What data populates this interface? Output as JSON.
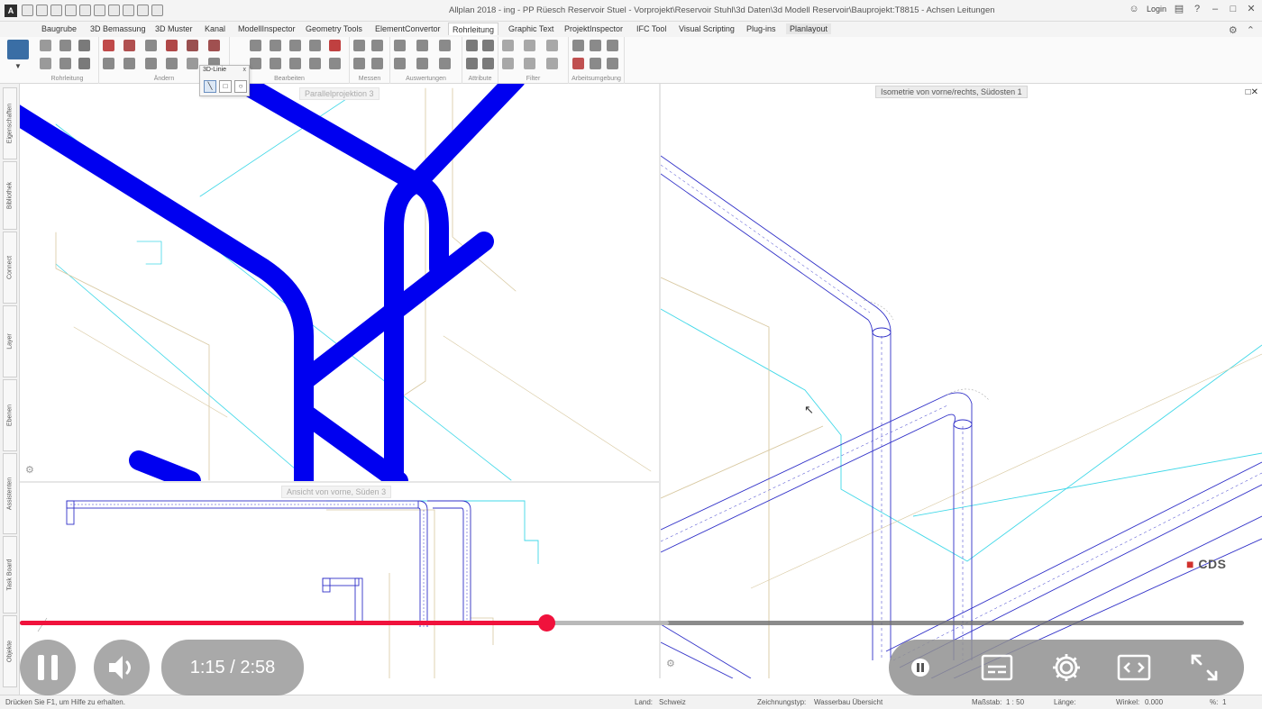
{
  "window": {
    "app_letter": "A",
    "title": "Allplan 2018 - ing - PP Rüesch Reservoir Stuel - Vorprojekt\\Reservoir Stuhl\\3d Daten\\3d Modell Reservoir\\Bauprojekt:T8815 - Achsen Leitungen",
    "login_label": "Login"
  },
  "ribbon": {
    "tabs": [
      "Baugrube",
      "3D Bemassung",
      "3D Muster",
      "Kanal",
      "ModellInspector",
      "Geometry Tools",
      "ElementConvertor",
      "Rohrleitung",
      "Graphic Text",
      "ProjektInspector",
      "IFC Tool",
      "Visual Scripting",
      "Plug-ins",
      "Planlayout"
    ],
    "active_tab": "Rohrleitung",
    "groups": [
      "Rohrleitung",
      "Ändern",
      "Bearbeiten",
      "Messen",
      "Auswertungen",
      "Attribute",
      "Filter",
      "Arbeitsumgebung"
    ]
  },
  "popup": {
    "title": "3D-Linie",
    "close": "x"
  },
  "sidebar": {
    "tabs": [
      "Eigenschaften",
      "Bibliothek",
      "Connect",
      "Layer",
      "Ebenen",
      "Assistenten",
      "Task Board",
      "Objekte"
    ]
  },
  "viewports": {
    "top_left_label": "Parallelprojektion 3",
    "bottom_left_label": "Ansicht von vorne, Süden 3",
    "right_label": "Isometrie von vorne/rechts, Südosten 1",
    "watermark": "CDS"
  },
  "statusbar": {
    "help": "Drücken Sie F1, um Hilfe zu erhalten.",
    "land_label": "Land:",
    "land_value": "Schweiz",
    "zeichnungstyp_label": "Zeichnungstyp:",
    "zeichnungstyp_value": "Wasserbau Übersicht",
    "massstab_label": "Maßstab:",
    "massstab_value": "1 : 50",
    "laenge_label": "Länge:",
    "winkel_label": "Winkel:",
    "winkel_value": "0.000",
    "percent_label": "%:",
    "percent_value": "1"
  },
  "video": {
    "time_display": "1:15 / 2:58",
    "current_time": "1:15",
    "duration": "2:58",
    "played_fraction": 0.43,
    "buffered_fraction": 0.53,
    "accent_color": "#f0123c"
  },
  "colors": {
    "pipe_blue": "#0000f0",
    "outline_blue": "#3030c8",
    "cyan_line": "#40d8e8",
    "tan_line": "#d8c8a0"
  }
}
